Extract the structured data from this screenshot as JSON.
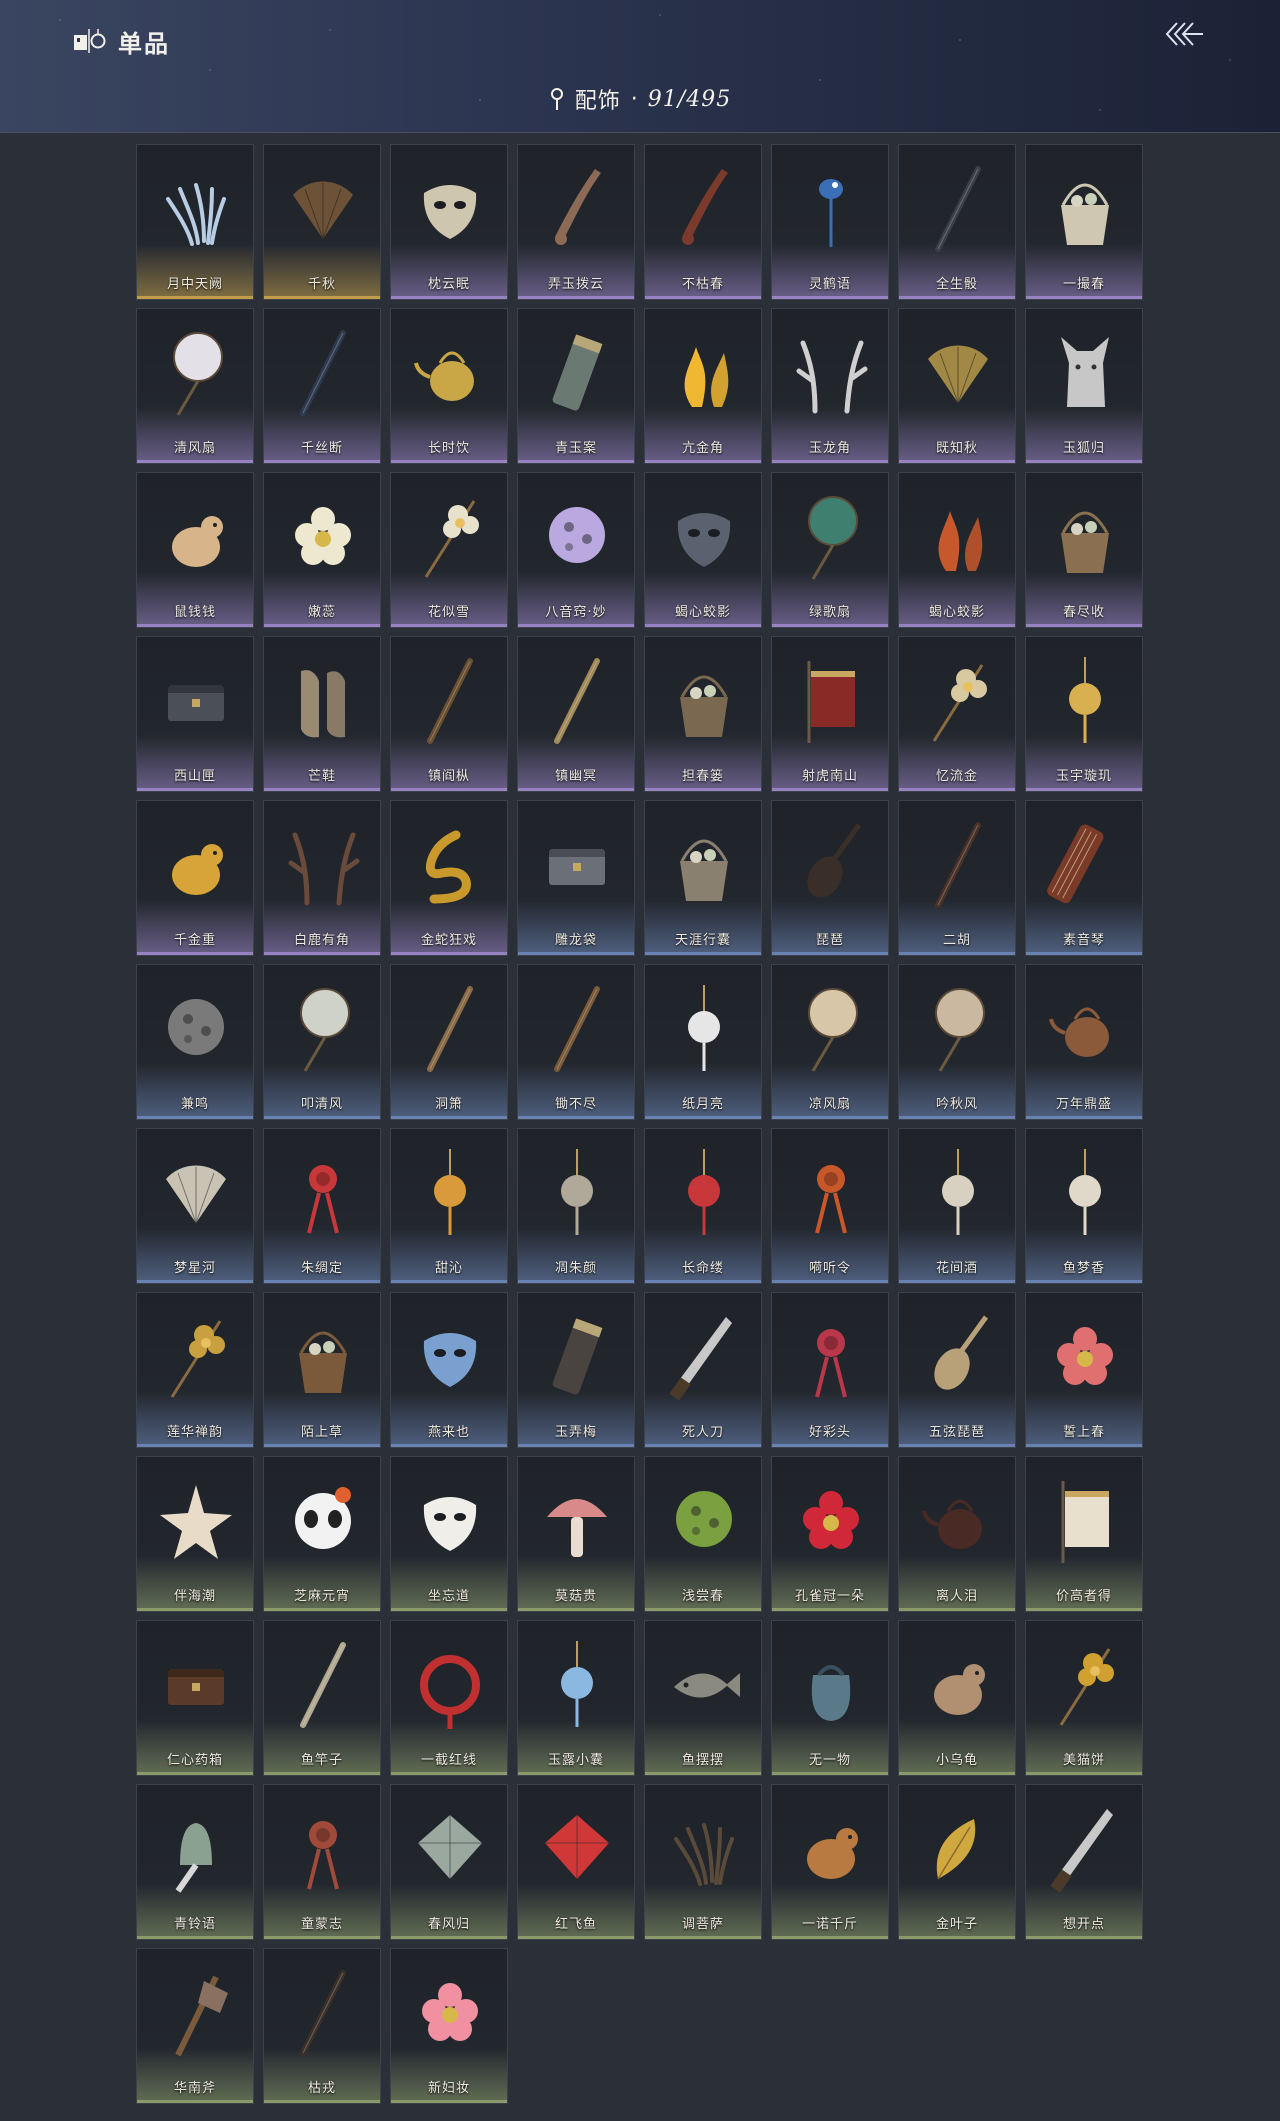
{
  "header": {
    "title": "单品",
    "title_icon": "collection-icon",
    "back_icon": "triple-chevron-left-icon",
    "category_icon": "pin-icon",
    "category": "配饰",
    "separator": "·",
    "count": "91/495"
  },
  "colors": {
    "gold": "#c9a24a",
    "purple": "#9d86c8",
    "blue": "#6c87b8",
    "green": "#8fa06a"
  },
  "items": [
    {
      "name": "月中天阙",
      "tint": "gold",
      "color": "#b8cde3",
      "shape": "claws"
    },
    {
      "name": "千秋",
      "tint": "gold",
      "color": "#7a5a3a",
      "shape": "fan"
    },
    {
      "name": "枕云眠",
      "tint": "purple",
      "color": "#cfc6b0",
      "shape": "mask"
    },
    {
      "name": "弄玉拨云",
      "tint": "purple",
      "color": "#8c6a55",
      "shape": "arm"
    },
    {
      "name": "不枯春",
      "tint": "purple",
      "color": "#7c3a2c",
      "shape": "arm"
    },
    {
      "name": "灵鹤语",
      "tint": "purple",
      "color": "#3a6fb8",
      "shape": "bird"
    },
    {
      "name": "全生骰",
      "tint": "purple",
      "color": "#3a3f48",
      "shape": "stick"
    },
    {
      "name": "一撮春",
      "tint": "purple",
      "color": "#cfc7b2",
      "shape": "basket"
    },
    {
      "name": "清风扇",
      "tint": "purple",
      "color": "#e3e0e8",
      "shape": "round-fan"
    },
    {
      "name": "千丝断",
      "tint": "purple",
      "color": "#2e3b4f",
      "shape": "stick"
    },
    {
      "name": "长时饮",
      "tint": "purple",
      "color": "#c9a646",
      "shape": "teapot"
    },
    {
      "name": "青玉案",
      "tint": "purple",
      "color": "#6a7a72",
      "shape": "scroll"
    },
    {
      "name": "亢金角",
      "tint": "purple",
      "color": "#f0b830",
      "shape": "flame"
    },
    {
      "name": "玉龙角",
      "tint": "purple",
      "color": "#cfcfcf",
      "shape": "antler"
    },
    {
      "name": "既知秋",
      "tint": "purple",
      "color": "#b89a4a",
      "shape": "fan"
    },
    {
      "name": "玉狐归",
      "tint": "purple",
      "color": "#d9d9d9",
      "shape": "fox"
    },
    {
      "name": "鼠钱钱",
      "tint": "purple",
      "color": "#d8b48a",
      "shape": "animal"
    },
    {
      "name": "嫩蕊",
      "tint": "purple",
      "color": "#efe8d0",
      "shape": "flower"
    },
    {
      "name": "花似雪",
      "tint": "purple",
      "color": "#e8e2cc",
      "shape": "flower-stick"
    },
    {
      "name": "八音窍·妙",
      "tint": "purple",
      "color": "#b9a9e0",
      "shape": "orb"
    },
    {
      "name": "蝎心蛟影",
      "tint": "purple",
      "color": "#5a6270",
      "shape": "mask"
    },
    {
      "name": "绿歌扇",
      "tint": "purple",
      "color": "#3f7f6f",
      "shape": "round-fan"
    },
    {
      "name": "蝎心蛟影",
      "tint": "purple",
      "color": "#c7582c",
      "shape": "flame"
    },
    {
      "name": "春尽收",
      "tint": "purple",
      "color": "#8a7050",
      "shape": "basket"
    },
    {
      "name": "西山匣",
      "tint": "purple",
      "color": "#4a4f58",
      "shape": "box"
    },
    {
      "name": "芒鞋",
      "tint": "purple",
      "color": "#9a8a72",
      "shape": "shoes"
    },
    {
      "name": "镇阎枞",
      "tint": "purple",
      "color": "#6a5030",
      "shape": "stick"
    },
    {
      "name": "镇幽冥",
      "tint": "purple",
      "color": "#a08a5a",
      "shape": "stick"
    },
    {
      "name": "担春篓",
      "tint": "purple",
      "color": "#7a6850",
      "shape": "basket"
    },
    {
      "name": "射虎南山",
      "tint": "purple",
      "color": "#8a2a26",
      "shape": "banner"
    },
    {
      "name": "忆流金",
      "tint": "purple",
      "color": "#d9c9a0",
      "shape": "flower-stick"
    },
    {
      "name": "玉宇璇玑",
      "tint": "purple",
      "color": "#d9b050",
      "shape": "pendant"
    },
    {
      "name": "千金重",
      "tint": "purple",
      "color": "#d6a438",
      "shape": "animal"
    },
    {
      "name": "白鹿有角",
      "tint": "purple",
      "color": "#6a4a3a",
      "shape": "antler"
    },
    {
      "name": "金蛇狂戏",
      "tint": "purple",
      "color": "#c9992c",
      "shape": "snake"
    },
    {
      "name": "雕龙袋",
      "tint": "blue",
      "color": "#6a6f78",
      "shape": "box"
    },
    {
      "name": "天涯行囊",
      "tint": "blue",
      "color": "#8a8070",
      "shape": "basket"
    },
    {
      "name": "琵琶",
      "tint": "blue",
      "color": "#3a2e28",
      "shape": "lute"
    },
    {
      "name": "二胡",
      "tint": "blue",
      "color": "#4a3228",
      "shape": "stick"
    },
    {
      "name": "素音琴",
      "tint": "blue",
      "color": "#7a3a28",
      "shape": "zither"
    },
    {
      "name": "兼鸣",
      "tint": "blue",
      "color": "#7a7a7a",
      "shape": "orb"
    },
    {
      "name": "叩清风",
      "tint": "blue",
      "color": "#cfd2c8",
      "shape": "round-fan"
    },
    {
      "name": "洞箫",
      "tint": "blue",
      "color": "#8a6a44",
      "shape": "stick"
    },
    {
      "name": "锄不尽",
      "tint": "blue",
      "color": "#7a5a3a",
      "shape": "stick"
    },
    {
      "name": "纸月亮",
      "tint": "blue",
      "color": "#e6e6e6",
      "shape": "pendant"
    },
    {
      "name": "凉风扇",
      "tint": "blue",
      "color": "#d8c6a8",
      "shape": "round-fan"
    },
    {
      "name": "吟秋风",
      "tint": "blue",
      "color": "#cbb8a0",
      "shape": "round-fan"
    },
    {
      "name": "万年鼎盛",
      "tint": "blue",
      "color": "#8a5a3a",
      "shape": "teapot"
    },
    {
      "name": "梦星河",
      "tint": "blue",
      "color": "#e6dfcc",
      "shape": "fan"
    },
    {
      "name": "朱绸定",
      "tint": "blue",
      "color": "#c8383a",
      "shape": "knot"
    },
    {
      "name": "甜沁",
      "tint": "blue",
      "color": "#d89a3a",
      "shape": "pendant"
    },
    {
      "name": "凋朱颜",
      "tint": "blue",
      "color": "#b0a898",
      "shape": "pendant"
    },
    {
      "name": "长命缕",
      "tint": "blue",
      "color": "#c8383a",
      "shape": "pendant"
    },
    {
      "name": "嗬听令",
      "tint": "blue",
      "color": "#c8572a",
      "shape": "knot"
    },
    {
      "name": "花间酒",
      "tint": "blue",
      "color": "#d8d0c0",
      "shape": "pendant"
    },
    {
      "name": "鱼梦香",
      "tint": "blue",
      "color": "#e0d8c8",
      "shape": "pendant"
    },
    {
      "name": "莲华禅韵",
      "tint": "blue",
      "color": "#c9a040",
      "shape": "flower-stick"
    },
    {
      "name": "陌上草",
      "tint": "blue",
      "color": "#7a5a3a",
      "shape": "basket"
    },
    {
      "name": "燕来也",
      "tint": "blue",
      "color": "#7aa0d0",
      "shape": "mask"
    },
    {
      "name": "玉弄梅",
      "tint": "blue",
      "color": "#4a4440",
      "shape": "scroll"
    },
    {
      "name": "死人刀",
      "tint": "blue",
      "color": "#c8c8c8",
      "shape": "blade"
    },
    {
      "name": "好彩头",
      "tint": "blue",
      "color": "#b8384a",
      "shape": "knot"
    },
    {
      "name": "五弦琵琶",
      "tint": "blue",
      "color": "#b8a078",
      "shape": "lute"
    },
    {
      "name": "誓上春",
      "tint": "blue",
      "color": "#e07070",
      "shape": "flower"
    },
    {
      "name": "伴海潮",
      "tint": "green",
      "color": "#e8dcc8",
      "shape": "star"
    },
    {
      "name": "芝麻元宵",
      "tint": "green",
      "color": "#f2f2f2",
      "shape": "panda"
    },
    {
      "name": "坐忘道",
      "tint": "green",
      "color": "#f0eee8",
      "shape": "mask"
    },
    {
      "name": "莫菇贵",
      "tint": "green",
      "color": "#d88a8a",
      "shape": "mushroom"
    },
    {
      "name": "浅尝春",
      "tint": "green",
      "color": "#7aa040",
      "shape": "orb"
    },
    {
      "name": "孔雀冠一朵",
      "tint": "green",
      "color": "#d02838",
      "shape": "flower"
    },
    {
      "name": "离人泪",
      "tint": "green",
      "color": "#4a2a24",
      "shape": "teapot"
    },
    {
      "name": "价高者得",
      "tint": "green",
      "color": "#e8e0cc",
      "shape": "banner"
    },
    {
      "name": "仁心药箱",
      "tint": "green",
      "color": "#5a3a28",
      "shape": "box"
    },
    {
      "name": "鱼竿子",
      "tint": "green",
      "color": "#b0a890",
      "shape": "stick"
    },
    {
      "name": "一截红线",
      "tint": "green",
      "color": "#c03030",
      "shape": "ring"
    },
    {
      "name": "玉露小囊",
      "tint": "green",
      "color": "#8ab8e0",
      "shape": "pendant"
    },
    {
      "name": "鱼摆摆",
      "tint": "green",
      "color": "#8a8a80",
      "shape": "fish"
    },
    {
      "name": "无一物",
      "tint": "green",
      "color": "#5a7a8a",
      "shape": "sack"
    },
    {
      "name": "小乌龟",
      "tint": "green",
      "color": "#b09070",
      "shape": "animal"
    },
    {
      "name": "美猫饼",
      "tint": "green",
      "color": "#d0a030",
      "shape": "flower-stick"
    },
    {
      "name": "青铃语",
      "tint": "green",
      "color": "#8aa090",
      "shape": "bell"
    },
    {
      "name": "童蒙志",
      "tint": "green",
      "color": "#a04a3a",
      "shape": "knot"
    },
    {
      "name": "春风归",
      "tint": "green",
      "color": "#9aa8a0",
      "shape": "kite"
    },
    {
      "name": "红飞鱼",
      "tint": "green",
      "color": "#d03838",
      "shape": "kite"
    },
    {
      "name": "调菩萨",
      "tint": "green",
      "color": "#5a4a3a",
      "shape": "claws"
    },
    {
      "name": "一诺千斤",
      "tint": "green",
      "color": "#b87a40",
      "shape": "animal"
    },
    {
      "name": "金叶子",
      "tint": "green",
      "color": "#d0a840",
      "shape": "leaf"
    },
    {
      "name": "想开点",
      "tint": "green",
      "color": "#c8c8c8",
      "shape": "blade"
    },
    {
      "name": "华南斧",
      "tint": "green",
      "color": "#8a7060",
      "shape": "axe"
    },
    {
      "name": "枯戎",
      "tint": "green",
      "color": "#3a3028",
      "shape": "stick"
    },
    {
      "name": "新妇妆",
      "tint": "green",
      "color": "#f090a0",
      "shape": "flower"
    }
  ]
}
